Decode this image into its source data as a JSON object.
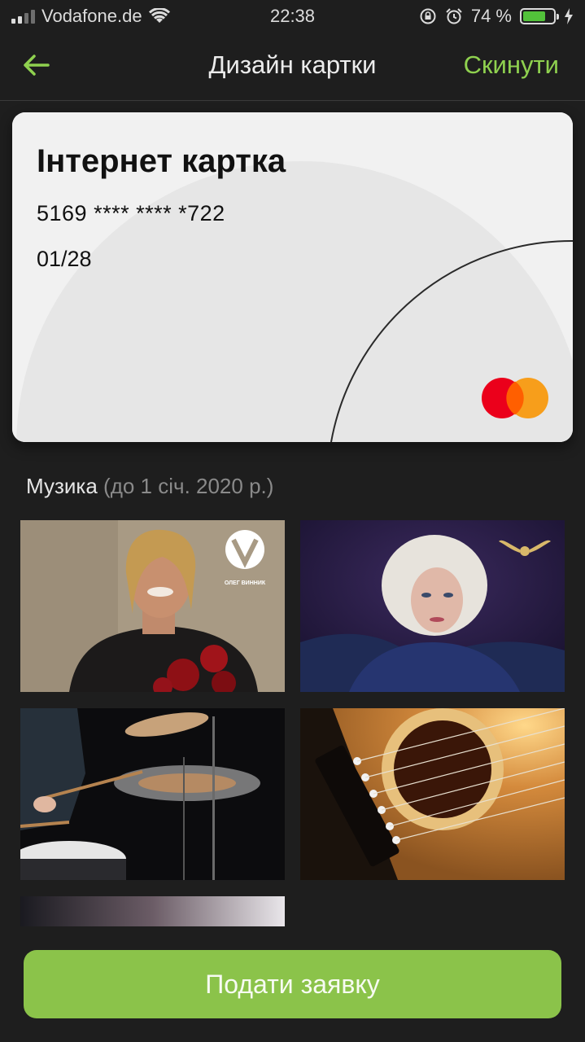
{
  "status_bar": {
    "carrier": "Vodafone.de",
    "time": "22:38",
    "battery_percent": "74 %",
    "battery_level": 0.74,
    "icons": [
      "signal-icon",
      "wifi-icon",
      "lock-rotation-icon",
      "alarm-icon",
      "battery-icon",
      "charging-icon"
    ]
  },
  "nav": {
    "title": "Дизайн картки",
    "reset_label": "Скинути",
    "back_icon": "arrow-left-icon"
  },
  "card": {
    "name": "Інтернет картка",
    "number": "5169 **** **** *722",
    "expiry": "01/28",
    "brand_icon": "mastercard-logo"
  },
  "section": {
    "title": "Музика",
    "subtitle": "(до 1 січ. 2020 р.)"
  },
  "tiles": [
    {
      "name": "design-oleg-vynnyk",
      "caption": "ОЛЕГ ВИННИК"
    },
    {
      "name": "design-blonde-singer",
      "caption": ""
    },
    {
      "name": "design-drums",
      "caption": ""
    },
    {
      "name": "design-guitar",
      "caption": ""
    },
    {
      "name": "design-partial",
      "caption": ""
    }
  ],
  "submit_label": "Подати заявку",
  "colors": {
    "accent": "#8fd14f",
    "button": "#8bc34a",
    "background": "#1e1e1e",
    "card": "#efefef"
  }
}
